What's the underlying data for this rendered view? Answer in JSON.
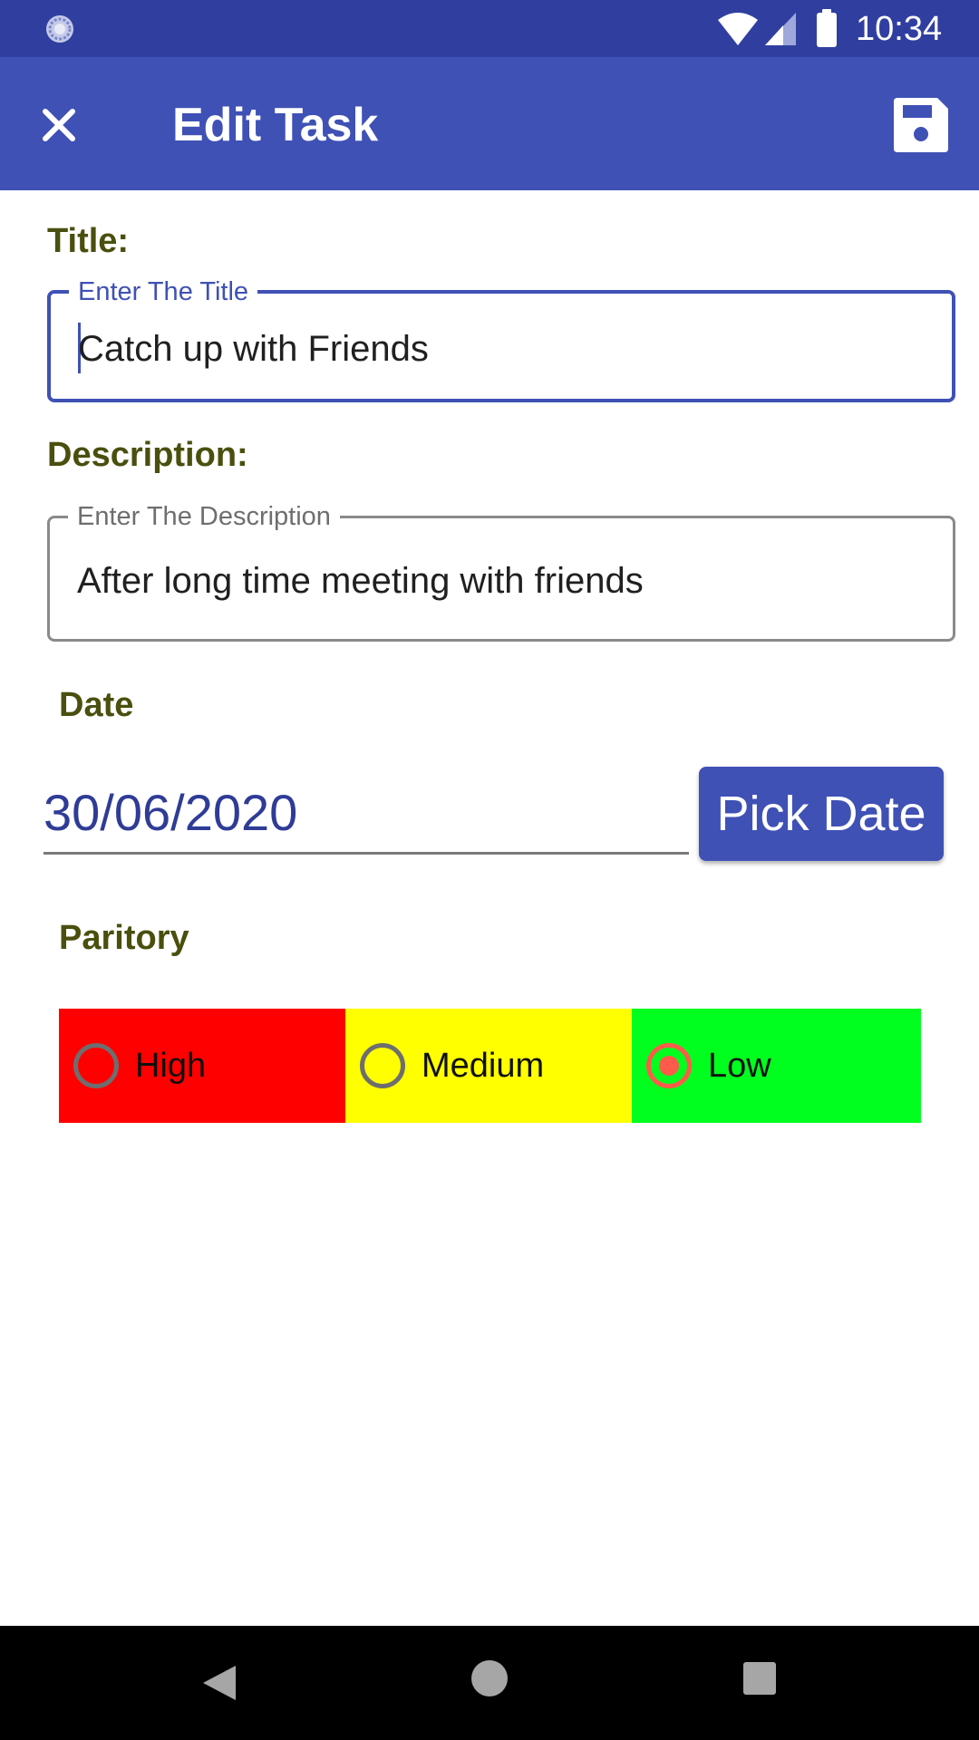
{
  "status_bar": {
    "time": "10:34",
    "left_icon": "sync-icon",
    "icons": [
      "wifi-icon",
      "signal-icon",
      "battery-icon"
    ],
    "background": "#303f9f"
  },
  "app_bar": {
    "title": "Edit Task",
    "close_icon": "close-icon",
    "save_icon": "save-icon",
    "background": "#3f51b5"
  },
  "form": {
    "title_label": "Title:",
    "title_field": {
      "hint": "Enter The Title",
      "value": "Catch up with Friends",
      "focused": true
    },
    "description_label": "Description:",
    "description_field": {
      "hint": "Enter The Description",
      "value": "After long time meeting with friends"
    },
    "date_label": "Date",
    "date_value": "30/06/2020",
    "pick_date_label": "Pick Date",
    "priority_label": "Paritory",
    "priority_options": [
      {
        "label": "High",
        "color": "#ff0000",
        "selected": false
      },
      {
        "label": "Medium",
        "color": "#ffff00",
        "selected": false
      },
      {
        "label": "Low",
        "color": "#00ff1e",
        "selected": true
      }
    ]
  },
  "colors": {
    "accent": "#3f51b5",
    "label_text": "#4b4f0e",
    "date_text": "#2f3c96"
  },
  "nav_bar": {
    "buttons": [
      "back-icon",
      "home-icon",
      "recents-icon"
    ]
  }
}
